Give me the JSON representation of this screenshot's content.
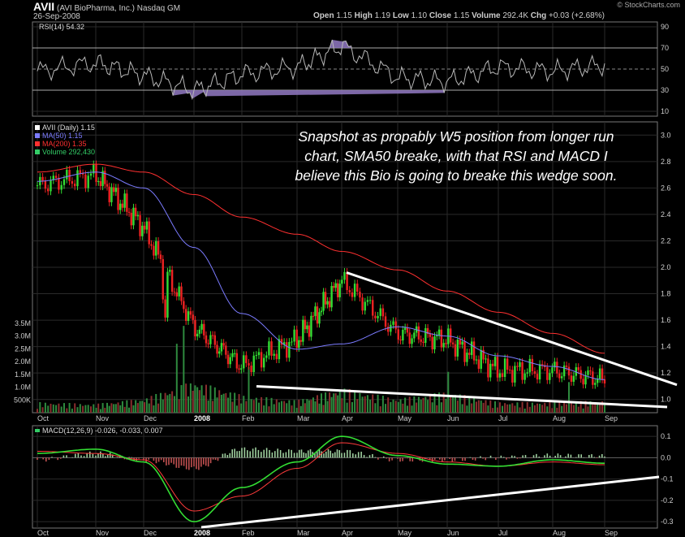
{
  "header": {
    "symbol": "AVII",
    "company": "(AVI BioPharma, Inc.)",
    "exchange": "Nasdaq GM",
    "date": "26-Sep-2008",
    "open_label": "Open",
    "open": "1.15",
    "high_label": "High",
    "high": "1.19",
    "low_label": "Low",
    "low": "1.10",
    "close_label": "Close",
    "close": "1.15",
    "volume_label": "Volume",
    "volume": "292.4K",
    "chg_label": "Chg",
    "chg": "+0.03 (+2.68%)",
    "watermark": "© StockCharts.com"
  },
  "rsi": {
    "label": "RSI(14) 54.32",
    "ticks": [
      "90",
      "70",
      "50",
      "30",
      "10"
    ]
  },
  "price": {
    "legend": [
      {
        "text": "AVII (Daily) 1.15",
        "color": "#ffffff"
      },
      {
        "text": "MA(50) 1.15",
        "color": "#7b7bff"
      },
      {
        "text": "MA(200) 1.35",
        "color": "#ff3030"
      },
      {
        "text": "Volume 292,430",
        "color": "#33cc66"
      }
    ],
    "ticks": [
      "3.0",
      "2.8",
      "2.6",
      "2.4",
      "2.2",
      "2.0",
      "1.8",
      "1.6",
      "1.4",
      "1.2",
      "1.0"
    ],
    "volume_ticks": [
      "3.5M",
      "3.0M",
      "2.5M",
      "2.0M",
      "1.5M",
      "1.0M",
      "500K"
    ],
    "annotation": [
      "Snapshot as propably W5 position from longer run",
      "chart, SMA50 breake, with that RSI and MACD I",
      "believe this Bio is going to breake this wedge soon."
    ]
  },
  "macd": {
    "label": "MACD(12,26,9) -0.026, -0.033, 0.007",
    "ticks": [
      "0.1",
      "0.0",
      "-0.1",
      "-0.2",
      "-0.3"
    ]
  },
  "x_axis": [
    "Oct",
    "Nov",
    "Dec",
    "2008",
    "Feb",
    "Mar",
    "Apr",
    "May",
    "Jun",
    "Jul",
    "Aug",
    "Sep"
  ],
  "colors": {
    "up": "#33dd33",
    "down": "#ee2222",
    "ma50": "#7b7bff",
    "ma200": "#ff3030",
    "grid": "#2a2a2a",
    "panel_border": "#777777"
  },
  "chart_data": [
    {
      "type": "line",
      "title": "RSI(14) 54.32",
      "ylim": [
        0,
        100
      ],
      "reference_lines": [
        70,
        50,
        30
      ],
      "x": [
        "Oct",
        "Nov",
        "Dec",
        "2008",
        "Feb",
        "Mar",
        "Apr",
        "May",
        "Jun",
        "Jul",
        "Aug",
        "Sep"
      ],
      "series": [
        {
          "name": "RSI(14)",
          "values": [
            48,
            56,
            44,
            30,
            45,
            52,
            72,
            42,
            38,
            52,
            48,
            54
          ]
        }
      ]
    },
    {
      "type": "line",
      "title": "AVII (Daily) 1.15",
      "ylim": [
        0.9,
        3.1
      ],
      "x": [
        "Oct",
        "Nov",
        "Dec",
        "2008",
        "Feb",
        "Mar",
        "Apr",
        "May",
        "Jun",
        "Jul",
        "Aug",
        "Sep"
      ],
      "series": [
        {
          "name": "AVII (Daily)",
          "values": [
            2.62,
            2.7,
            2.3,
            1.55,
            1.25,
            1.45,
            1.9,
            1.5,
            1.45,
            1.22,
            1.22,
            1.15
          ]
        },
        {
          "name": "MA(50)",
          "values": [
            2.65,
            2.72,
            2.6,
            2.15,
            1.65,
            1.38,
            1.42,
            1.55,
            1.48,
            1.33,
            1.25,
            1.15
          ]
        },
        {
          "name": "MA(200)",
          "values": [
            2.72,
            2.78,
            2.72,
            2.55,
            2.38,
            2.25,
            2.12,
            1.98,
            1.82,
            1.66,
            1.5,
            1.35
          ]
        }
      ],
      "annotations": [
        "Snapshot as propably W5 position from longer run chart, SMA50 breake, with that RSI and MACD I believe this Bio is going to breake this wedge soon."
      ],
      "trendlines": [
        {
          "from": [
            "Apr",
            1.96
          ],
          "to": [
            "Sep",
            1.16
          ]
        },
        {
          "from": [
            "Feb",
            1.1
          ],
          "to": [
            "Sep",
            0.98
          ]
        }
      ]
    },
    {
      "type": "bar",
      "title": "Volume 292,430",
      "ylim": [
        0,
        3500000
      ],
      "x": [
        "Oct",
        "Nov",
        "Dec",
        "2008",
        "Feb",
        "Mar",
        "Apr",
        "May",
        "Jun",
        "Jul",
        "Aug",
        "Sep"
      ],
      "series": [
        {
          "name": "Volume",
          "values": [
            300000,
            250000,
            400000,
            900000,
            500000,
            350000,
            700000,
            400000,
            600000,
            300000,
            300000,
            350000
          ]
        }
      ]
    },
    {
      "type": "line",
      "title": "MACD(12,26,9) -0.026, -0.033, 0.007",
      "ylim": [
        -0.33,
        0.15
      ],
      "x": [
        "Oct",
        "Nov",
        "Dec",
        "2008",
        "Feb",
        "Mar",
        "Apr",
        "May",
        "Jun",
        "Jul",
        "Aug",
        "Sep"
      ],
      "series": [
        {
          "name": "MACD",
          "values": [
            0.02,
            0.04,
            -0.02,
            -0.3,
            -0.14,
            -0.02,
            0.1,
            0.01,
            -0.03,
            -0.04,
            -0.01,
            -0.026
          ]
        },
        {
          "name": "Signal",
          "values": [
            0.03,
            0.02,
            -0.01,
            -0.25,
            -0.18,
            -0.05,
            0.07,
            0.02,
            -0.02,
            -0.04,
            -0.02,
            -0.033
          ]
        },
        {
          "name": "Histogram",
          "values": [
            -0.01,
            0.02,
            -0.01,
            -0.05,
            0.04,
            0.03,
            0.03,
            -0.01,
            -0.01,
            0.0,
            0.01,
            0.007
          ]
        }
      ],
      "trendlines": [
        {
          "from": [
            "2008",
            -0.33
          ],
          "to": [
            "Sep",
            -0.09
          ]
        }
      ]
    }
  ]
}
